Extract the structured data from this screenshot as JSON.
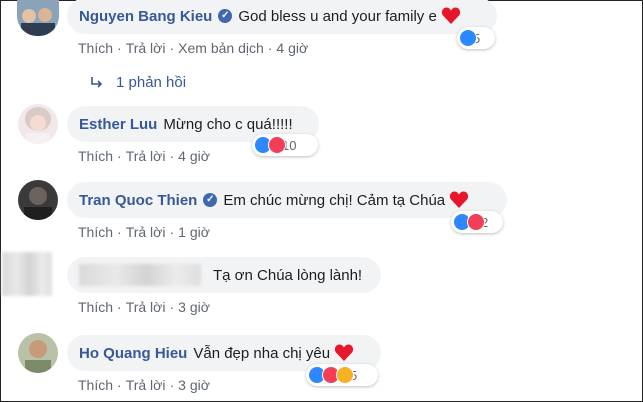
{
  "colors": {
    "link_blue": "#385898",
    "bubble_bg": "#f2f3f5",
    "meta_gray": "#606770",
    "like_blue": "#2d88ff",
    "love_red": "#f33e58"
  },
  "comments": [
    {
      "name": "Nguyen Bang Kieu",
      "verified": true,
      "text": "God bless u and your family e",
      "emoji": "red-heart",
      "actions": [
        "Thích",
        "Trả lời",
        "Xem bản dịch",
        "4 giờ"
      ],
      "reactions": [
        "like"
      ],
      "reaction_count": "5",
      "replies": "1 phản hồi"
    },
    {
      "name": "Esther Luu",
      "verified": false,
      "text": "Mừng cho c quá!!!!!",
      "actions": [
        "Thích",
        "Trả lời",
        "4 giờ"
      ],
      "reactions": [
        "like",
        "love"
      ],
      "reaction_count": "10"
    },
    {
      "name": "Tran Quoc Thien",
      "verified": true,
      "text": "Em chúc mừng chị! Cảm tạ Chúa",
      "emoji": "red-heart",
      "actions": [
        "Thích",
        "Trả lời",
        "1 giờ"
      ],
      "reactions": [
        "like",
        "love"
      ],
      "reaction_count": "2"
    },
    {
      "name": "",
      "verified": false,
      "text": "Tạ ơn Chúa lòng lành!",
      "actions": [
        "Thích",
        "Trả lời",
        "3 giờ"
      ]
    },
    {
      "name": "Ho Quang Hieu",
      "verified": false,
      "text": "Vẫn đẹp nha chị yêu",
      "emoji": "red-heart",
      "actions": [
        "Thích",
        "Trả lời",
        "3 giờ"
      ],
      "reactions": [
        "like",
        "love",
        "haha"
      ],
      "reaction_count": "5"
    }
  ]
}
